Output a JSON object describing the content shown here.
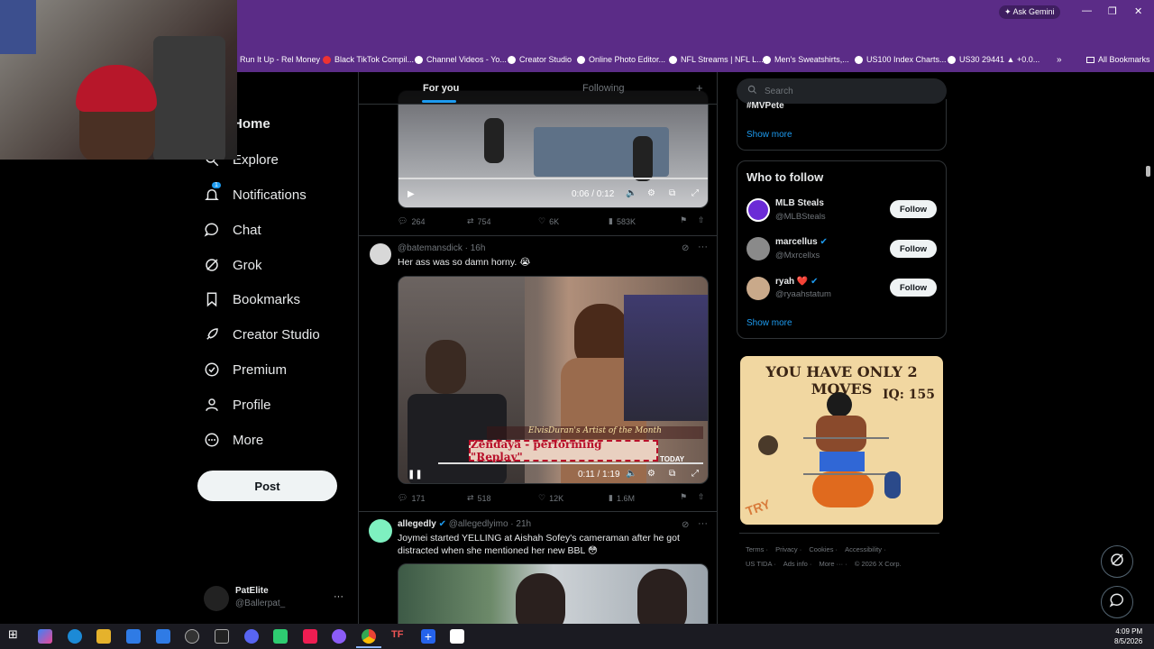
{
  "browser": {
    "ask_gemini": "Ask Gemini",
    "bookmarks": [
      "Run It Up - Rel Money",
      "Black TikTok Compil...",
      "Channel Videos - Yo...",
      "Creator Studio",
      "Online Photo Editor...",
      "NFL Streams | NFL L...",
      "Men's Sweatshirts,...",
      "US100 Index Charts...",
      "US30 29441 ▲ +0.0...",
      "All Bookmarks"
    ]
  },
  "nav": {
    "items": [
      "Home",
      "Explore",
      "Notifications",
      "Chat",
      "Grok",
      "Bookmarks",
      "Creator Studio",
      "Premium",
      "Profile",
      "More"
    ],
    "notification_badge": "1",
    "post_label": "Post",
    "account_name": "PatElite",
    "account_handle": "@Ballerpat_",
    "account_more": "···"
  },
  "timeline": {
    "tabs": [
      "For you",
      "Following"
    ],
    "add_tab": "+",
    "tweets": [
      {
        "video_time": "0:06 / 0:12",
        "replies": "264",
        "reposts": "754",
        "likes": "6K",
        "views": "583K"
      },
      {
        "handle_time": "@batemansdick · 16h",
        "text": "Her ass was so damn horny. 😭",
        "video_time": "0:11 / 1:19",
        "overlay_title": "ElvisDuran's Artist of the Month",
        "overlay_banner": "Zendaya - performing \"Replay\"",
        "overlay_logo": "TODAY",
        "replies": "171",
        "reposts": "518",
        "likes": "12K",
        "views": "1.6M"
      },
      {
        "name": "allegedly",
        "handle_time": "@allegedlyimo · 21h",
        "text_line1": "Joymei started YELLING at Aishah Sofey's cameraman after he got",
        "text_line2": "distracted when she mentioned her new BBL 😳"
      }
    ]
  },
  "right": {
    "search_placeholder": "Search",
    "trend_partial": "#MVPete",
    "show_more": "Show more",
    "who_to_follow": "Who to follow",
    "suggestions": [
      {
        "name": "MLB Steals",
        "handle": "@MLBSteals",
        "action": "Follow",
        "color": "#6b2bd6"
      },
      {
        "name": "marcellus",
        "handle": "@Mxrcellxs",
        "action": "Follow",
        "color": "#8a8a8a"
      },
      {
        "name": "ryah ❤️",
        "handle": "@ryaahstatum",
        "action": "Follow",
        "color": "#c9a98a"
      }
    ],
    "ad_title": "YOU HAVE ONLY 2 MOVES",
    "ad_iq": "IQ: 155",
    "ad_try": "TRY",
    "footer_line1": [
      "Terms",
      "Privacy",
      "Cookies",
      "Accessibility"
    ],
    "footer_line2": [
      "US TIDA",
      "Ads info",
      "More ···",
      "© 2026 X Corp."
    ]
  },
  "taskbar": {
    "time": "4:09 PM",
    "date": "8/5/2026"
  },
  "colors": {
    "browser_purple": "#5b2c87",
    "accent_blue": "#1d9bf0",
    "background": "#000000",
    "border": "#2f3336"
  }
}
